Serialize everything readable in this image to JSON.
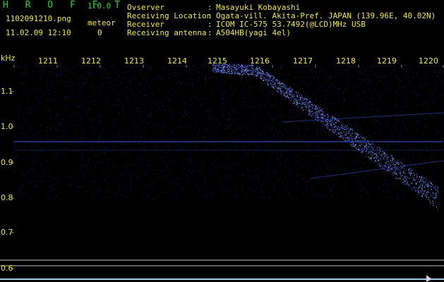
{
  "header": {
    "app_title": "H R O F F T",
    "version": "1.0.0",
    "filename": "1102091210.png",
    "datetime": "11.02.09 12:10",
    "meteor_label": "meteor",
    "meteor_count": "0",
    "info": [
      {
        "key": "Ovserver",
        "value": "Masayuki Kobayashi"
      },
      {
        "key": "Receiving Location",
        "value": "Ogata-vill. Akita-Pref. JAPAN (139.96E, 40.02N)"
      },
      {
        "key": "Receiver",
        "value": "ICOM IC-575 53.7492(@LCD)MHz USB"
      },
      {
        "key": "Receiving antenna",
        "value": "A504HB(yagi 4el)"
      }
    ]
  },
  "spectrogram": {
    "y_unit": "kHz",
    "x_ticks": [
      "1211",
      "1212",
      "1213",
      "1214",
      "1215",
      "1216",
      "1217",
      "1218",
      "1219",
      "1220"
    ],
    "y_ticks": [
      "1.1",
      "1.0",
      "0.9",
      "0.8",
      "0.7",
      "0.6"
    ],
    "colors": {
      "background": "#000000",
      "noise": "#1a2a9a",
      "signal": "#4a6cff",
      "signal_bright": "#9fb4ff",
      "label": "#f0f000",
      "green": "#10e010"
    }
  }
}
